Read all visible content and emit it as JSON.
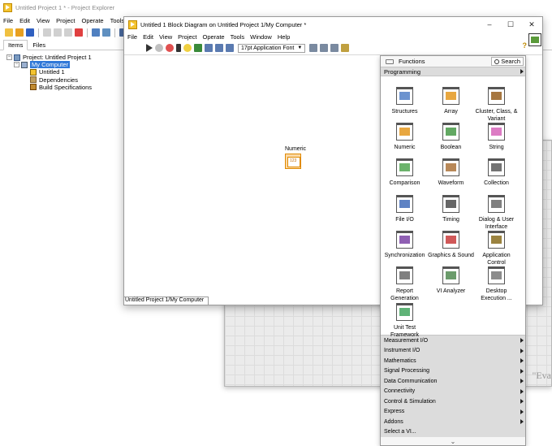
{
  "project_explorer": {
    "title": "Untitled Project 1 * - Project Explorer",
    "menu": [
      "File",
      "Edit",
      "View",
      "Project",
      "Operate",
      "Tools"
    ],
    "tabs": [
      "Items",
      "Files"
    ],
    "tree": {
      "root": "Project: Untitled Project 1",
      "computer": "My Computer",
      "children": [
        "Untitled 1",
        "Dependencies",
        "Build Specifications"
      ]
    }
  },
  "block_diagram": {
    "title": "Untitled 1 Block Diagram on Untitled Project 1/My Computer *",
    "menu": [
      "File",
      "Edit",
      "View",
      "Project",
      "Operate",
      "Tools",
      "Window",
      "Help"
    ],
    "font": "17pt Application Font",
    "numeric_label": "Numeric",
    "numeric_glyph": "123",
    "status": "Untitled Project 1/My Computer",
    "window_controls": [
      "–",
      "☐",
      "✕"
    ],
    "help_label": "?"
  },
  "front_panel_text": "\"Eva",
  "functions": {
    "title": "Functions",
    "search": "Search",
    "category": "Programming",
    "items": [
      {
        "label": "Structures",
        "color": "#3b6fbf"
      },
      {
        "label": "Array",
        "color": "#e08a00"
      },
      {
        "label": "Cluster, Class, & Variant",
        "color": "#8a4a00"
      },
      {
        "label": "Numeric",
        "color": "#e08a00"
      },
      {
        "label": "Boolean",
        "color": "#2e8b2e"
      },
      {
        "label": "String",
        "color": "#d050b0"
      },
      {
        "label": "Comparison",
        "color": "#3a9a3a"
      },
      {
        "label": "Waveform",
        "color": "#a06020"
      },
      {
        "label": "Collection",
        "color": "#444444"
      },
      {
        "label": "File I/O",
        "color": "#2a5ab0"
      },
      {
        "label": "Timing",
        "color": "#333333"
      },
      {
        "label": "Dialog & User Interface",
        "color": "#555555"
      },
      {
        "label": "Synchronization",
        "color": "#6a2a9a"
      },
      {
        "label": "Graphics & Sound",
        "color": "#c02020"
      },
      {
        "label": "Application Control",
        "color": "#7a5a00"
      },
      {
        "label": "Report Generation",
        "color": "#555555"
      },
      {
        "label": "VI Analyzer",
        "color": "#3a7a3a"
      },
      {
        "label": "Desktop Execution ...",
        "color": "#666666"
      },
      {
        "label": "Unit Test Framework",
        "color": "#2a9a4a"
      }
    ],
    "categories": [
      "Measurement I/O",
      "Instrument I/O",
      "Mathematics",
      "Signal Processing",
      "Data Communication",
      "Connectivity",
      "Control & Simulation",
      "Express",
      "Addons",
      "Select a VI..."
    ],
    "more_label": "⌄"
  }
}
